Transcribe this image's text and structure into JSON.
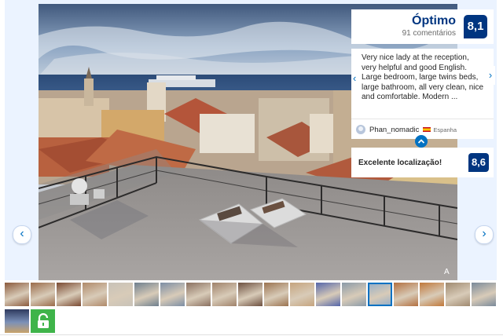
{
  "gallery": {
    "main_photo_alt": "",
    "prev_arrow": "‹",
    "next_arrow": "›"
  },
  "score": {
    "word": "Óptimo",
    "count": "91 comentários",
    "value": "8,1"
  },
  "review": {
    "text": "Very nice lady at the reception, very helpful and good English. Large bedroom, large twins beds, large bathroom, all very clean, nice and comfortable. Modern ...",
    "reviewer_name": "Phan_nomadic",
    "reviewer_country": "Espanha",
    "prev_arrow": "‹",
    "next_arrow": "›",
    "collapse_glyph": "︿"
  },
  "location": {
    "label": "Excelente localização!",
    "value": "8,6"
  },
  "thumbnails": {
    "colors": [
      "#8b5a3c",
      "#9a6b4a",
      "#7a4a32",
      "#b08a6a",
      "#c8c2b8",
      "#6e7f8e",
      "#7c8ea4",
      "#8a7060",
      "#a0826a",
      "#6d5040",
      "#9b7350",
      "#c5a47e",
      "#5566aa",
      "#8a9aa8",
      "#9bb0c6",
      "#b37040",
      "#c0783a",
      "#a08a70",
      "#7a8a9a"
    ],
    "selected_index": 14,
    "row2_first": "#4a6e9a",
    "lock_icon": "lock-open-icon"
  }
}
